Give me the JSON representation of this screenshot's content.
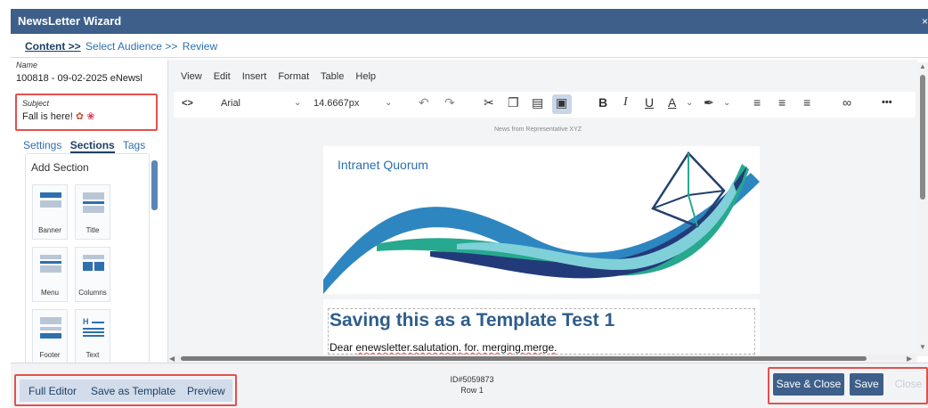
{
  "window": {
    "title": "NewsLetter Wizard",
    "close_glyph": "×"
  },
  "steps": [
    "Content >>",
    "Select Audience >>",
    "Review"
  ],
  "left": {
    "name_label": "Name",
    "name_value": "100818 - 09-02-2025 eNewsl",
    "subject_label": "Subject",
    "subject_value": "Fall is here!",
    "tabs": [
      "Settings",
      "Sections",
      "Tags"
    ],
    "add_section_title": "Add Section",
    "tiles": [
      "Banner",
      "Title",
      "Menu",
      "Columns",
      "Footer",
      "Text"
    ]
  },
  "editor": {
    "menu": [
      "View",
      "Edit",
      "Insert",
      "Format",
      "Table",
      "Help"
    ],
    "code_icon": "<>",
    "font_family": "Arial",
    "font_size": "14.6667px",
    "news_from": "News from Representative XYZ",
    "banner_title": "Intranet Quorum",
    "heading": "Saving this as a Template Test 1",
    "dear_prefix": "Dear ",
    "dear_merge": "enewsletter.salutation. for. merging.merge.",
    "toolbar_letters": {
      "bold": "B",
      "italic": "I",
      "underline": "U",
      "text_color": "A",
      "more": "•••"
    }
  },
  "footer": {
    "full_editor": "Full Editor",
    "save_as_template": "Save as Template",
    "preview": "Preview",
    "id_line": "ID#5059873",
    "row_line": "Row 1",
    "save_close": "Save & Close",
    "save": "Save",
    "close": "Close"
  },
  "colors": {
    "header": "#3d5f8a",
    "link": "#2e6fae",
    "highlight_box": "#e0524e"
  }
}
